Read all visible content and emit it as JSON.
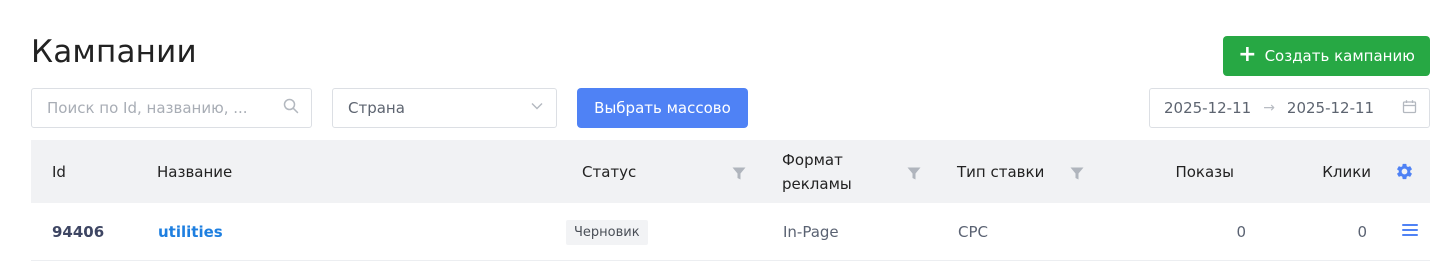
{
  "page": {
    "title": "Кампании"
  },
  "toolbar": {
    "create_label": "Создать кампанию",
    "search_placeholder": "Поиск по Id, названию, ...",
    "country_value": "Страна",
    "bulk_label": "Выбрать массово",
    "date_from": "2025-12-11",
    "date_to": "2025-12-11"
  },
  "table": {
    "headers": {
      "id": "Id",
      "name": "Название",
      "status": "Статус",
      "format": "Формат рекламы",
      "format_line1": "Формат",
      "format_line2": "рекламы",
      "bid_type": "Тип ставки",
      "impressions": "Показы",
      "clicks": "Клики"
    },
    "rows": [
      {
        "id": "94406",
        "name": "utilities",
        "status": "Черновик",
        "format": "In-Page",
        "bid_type": "CPC",
        "impressions": "0",
        "clicks": "0"
      }
    ]
  },
  "colors": {
    "create_button": "#27a844",
    "bulk_button": "#4f82f5",
    "link": "#1e7fe0",
    "header_bg": "#f1f2f4"
  },
  "icons": {
    "create": "plus-icon",
    "search": "search-icon",
    "select": "chevron-down-icon",
    "date_separator": "arrow-right-icon",
    "calendar": "calendar-icon",
    "filter": "filter-icon",
    "settings": "gear-icon",
    "row_menu": "menu-icon"
  }
}
